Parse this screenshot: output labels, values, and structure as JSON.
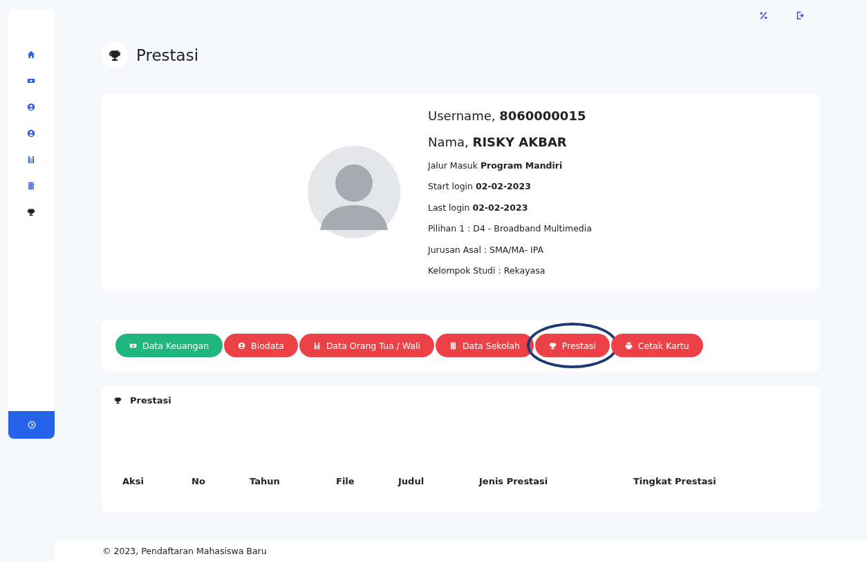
{
  "sidebar": {
    "items": [
      {
        "kind": "home",
        "selected": false
      },
      {
        "kind": "money",
        "selected": false
      },
      {
        "kind": "user",
        "selected": false
      },
      {
        "kind": "user",
        "selected": false
      },
      {
        "kind": "family",
        "selected": false
      },
      {
        "kind": "building",
        "selected": false
      },
      {
        "kind": "trophy",
        "selected": true
      }
    ],
    "toggle": {
      "kind": "chevron"
    }
  },
  "topbar": {
    "actions": [
      {
        "kind": "percent"
      },
      {
        "kind": "logout"
      }
    ]
  },
  "page": {
    "title": "Prestasi"
  },
  "profile": {
    "username_label": "Username,",
    "username": "8060000015",
    "name_label": "Nama,",
    "name": "RISKY AKBAR",
    "lines": [
      "Jalur Masuk **Program Mandiri**",
      "Start login **02-02-2023**",
      "Last login **02-02-2023**",
      "Pilihan 1 : D4 - Broadband Multimedia",
      "Jurusan Asal : SMA/MA- IPA",
      "Kelompok Studi : Rekayasa"
    ]
  },
  "menu_buttons": [
    {
      "label": "Data Keuangan",
      "kind": "money",
      "color": "#1fb77f",
      "circled": false
    },
    {
      "label": "Biodata",
      "kind": "user",
      "color": "#ec4146",
      "circled": false
    },
    {
      "label": "Data Orang Tua / Wali",
      "kind": "family",
      "color": "#ec4146",
      "circled": false
    },
    {
      "label": "Data Sekolah",
      "kind": "building",
      "color": "#ec4146",
      "circled": false
    },
    {
      "label": "Prestasi",
      "kind": "trophy",
      "color": "#ec4146",
      "circled": true
    },
    {
      "label": "Cetak Kartu",
      "kind": "printer",
      "color": "#ec4146",
      "circled": false
    }
  ],
  "section": {
    "title": "Prestasi",
    "table": {
      "columns": [
        "Aksi",
        "No",
        "Tahun",
        "File",
        "Judul",
        "Jenis Prestasi",
        "Tingkat Prestasi"
      ]
    }
  },
  "footer": "© 2023, Pendaftaran Mahasiswa Baru"
}
